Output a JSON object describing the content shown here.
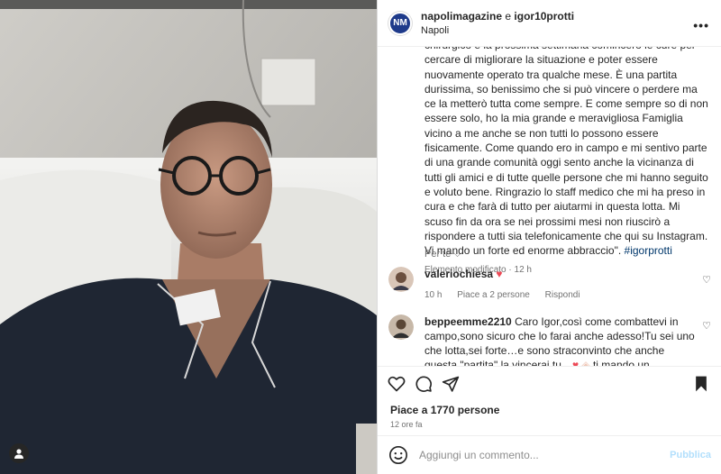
{
  "colors": {
    "accent": "#0095f6",
    "publish_disabled": "#b2dffc",
    "heart": "#ed4956",
    "text": "#262626",
    "muted": "#737373",
    "link": "#00376b"
  },
  "post": {
    "author": "napolimagazine",
    "conjunction": "e",
    "coauthor": "igor10protti",
    "location": "Napoli",
    "more_icon": "more-horizontal-icon"
  },
  "caption": {
    "text": "chirurgico e la prossima settimana comincerò le cure per cercare di migliorare la situazione e poter essere nuovamente operato tra qualche mese. È una partita durissima, so benissimo che si può vincere o perdere ma ce la metterò tutta come sempre. E come sempre so di non essere solo, ho la mia grande e meravigliosa Famiglia vicino a me anche se non tutti lo possono essere fisicamente. Come quando ero in campo e mi sentivo parte di una grande comunità oggi sento anche la vicinanza di tutti gli amici e di tutte quelle persone che mi hanno seguito e voluto bene. Ringrazio lo staff medico che mi ha preso in cura e che farà di tutto per aiutarmi in questa lotta. Mi scuso fin da ora se nei prossimi mesi non riuscirò a rispondere a tutti sia telefonicamente che qui su Instagram. Vi mando un forte ed enorme abbraccio\". ",
    "hashtag": "#igorprotti",
    "edited": "Elemento modificato",
    "dot": "·",
    "edited_time": "12 h"
  },
  "translate_label": "Per te",
  "comments": [
    {
      "user": "valeriochiesa",
      "text": "",
      "emoji": "♥",
      "time": "10 h",
      "likes": "Piace a 2 persone",
      "reply": "Rispondi"
    },
    {
      "user": "beppeemme2210",
      "text": "Caro Igor,così come combattevi in campo,sono sicuro che lo farai anche adesso!Tu sei uno che lotta,sei forte…e sono straconvinto che anche questa \"partita\" la vincerai tu…",
      "tail": " ti mando un immenso abbraccio da"
    }
  ],
  "actions": {
    "like_icon": "heart-outline-icon",
    "comment_icon": "comment-icon",
    "share_icon": "paper-plane-icon",
    "save_icon": "bookmark-icon"
  },
  "likes_text": "Piace a 1770 persone",
  "time_text": "12 ore fa",
  "composer": {
    "placeholder": "Aggiungi un commento...",
    "publish": "Pubblica"
  }
}
